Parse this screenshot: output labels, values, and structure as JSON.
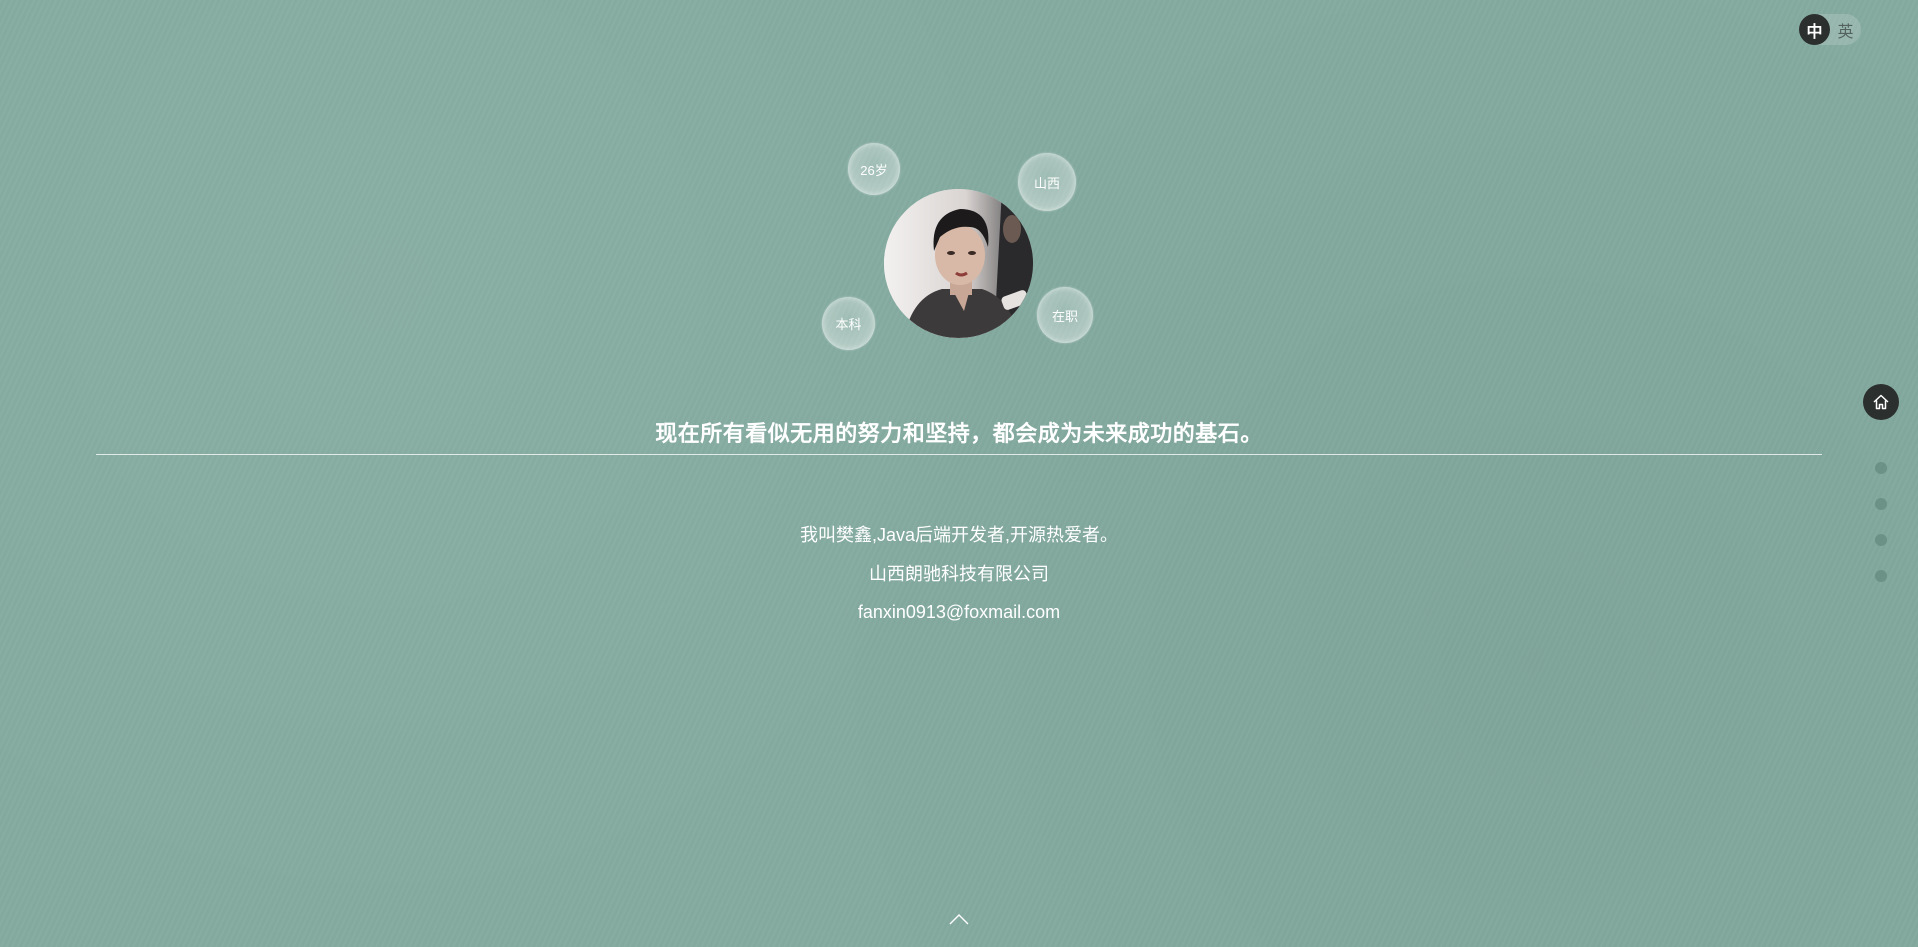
{
  "lang_toggle": {
    "active_label": "中",
    "inactive_label": "英"
  },
  "profile": {
    "tags": {
      "age": "26岁",
      "region": "山西",
      "education": "本科",
      "status": "在职"
    }
  },
  "motto": "现在所有看似无用的努力和坚持，都会成为未来成功的基石。",
  "intro": {
    "line1": "我叫樊鑫,Java后端开发者,开源热爱者。",
    "line2": "山西朗驰科技有限公司",
    "line3": "fanxin0913@foxmail.com"
  },
  "side_nav": {
    "items": [
      "home-icon",
      "section-2",
      "section-3",
      "section-4",
      "section-5"
    ],
    "active_index": 0
  },
  "icons": {
    "home": "home-icon",
    "scroll_up": "chevron-up-icon"
  },
  "colors": {
    "background": "#85aca1",
    "accent_dark": "#2b2f2e",
    "text": "#ffffff"
  }
}
